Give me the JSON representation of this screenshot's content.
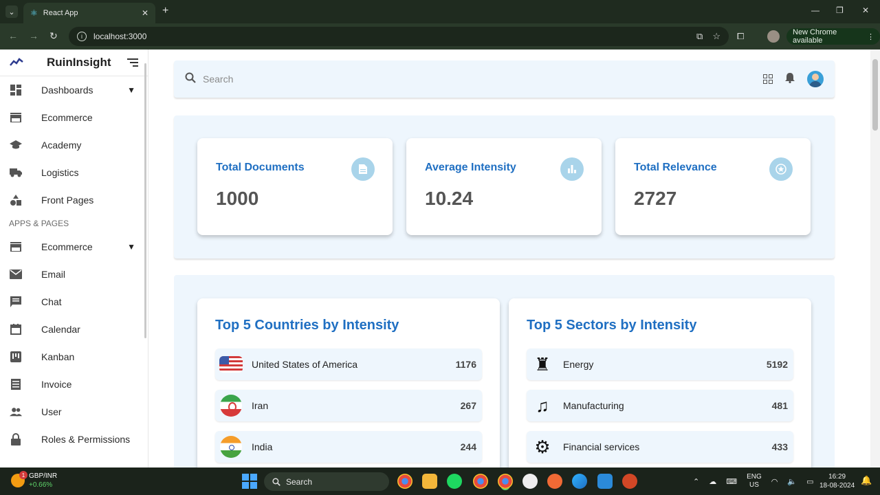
{
  "browser": {
    "tab_title": "React App",
    "url": "localhost:3000",
    "update_label": "New Chrome available"
  },
  "sidebar": {
    "brand": "RuinInsight",
    "items_top": [
      {
        "label": "Dashboards",
        "icon": "dashboard-icon",
        "expandable": true
      },
      {
        "label": "Ecommerce",
        "icon": "store-icon",
        "expandable": false
      },
      {
        "label": "Academy",
        "icon": "graduation-cap-icon",
        "expandable": false
      },
      {
        "label": "Logistics",
        "icon": "truck-icon",
        "expandable": false
      },
      {
        "label": "Front Pages",
        "icon": "shapes-icon",
        "expandable": false
      }
    ],
    "section_label": "APPS & PAGES",
    "items_apps": [
      {
        "label": "Ecommerce",
        "icon": "store-icon",
        "expandable": true
      },
      {
        "label": "Email",
        "icon": "email-icon",
        "expandable": false
      },
      {
        "label": "Chat",
        "icon": "chat-icon",
        "expandable": false
      },
      {
        "label": "Calendar",
        "icon": "calendar-icon",
        "expandable": false
      },
      {
        "label": "Kanban",
        "icon": "kanban-icon",
        "expandable": false
      },
      {
        "label": "Invoice",
        "icon": "invoice-icon",
        "expandable": false
      },
      {
        "label": "User",
        "icon": "users-icon",
        "expandable": false
      },
      {
        "label": "Roles & Permissions",
        "icon": "lock-icon",
        "expandable": false
      }
    ]
  },
  "topbar": {
    "search_placeholder": "Search"
  },
  "stats": [
    {
      "title": "Total Documents",
      "value": "1000",
      "icon": "document-icon"
    },
    {
      "title": "Average Intensity",
      "value": "10.24",
      "icon": "bar-chart-icon"
    },
    {
      "title": "Total Relevance",
      "value": "2727",
      "icon": "star-icon"
    }
  ],
  "countries": {
    "title": "Top 5 Countries by Intensity",
    "rows": [
      {
        "name": "United States of America",
        "value": "1176",
        "flag": "us"
      },
      {
        "name": "Iran",
        "value": "267",
        "flag": "ir"
      },
      {
        "name": "India",
        "value": "244",
        "flag": "in"
      }
    ]
  },
  "sectors": {
    "title": "Top 5 Sectors by Intensity",
    "rows": [
      {
        "name": "Energy",
        "value": "5192",
        "icon": "chess-rook-icon"
      },
      {
        "name": "Manufacturing",
        "value": "481",
        "icon": "music-note-icon"
      },
      {
        "name": "Financial services",
        "value": "433",
        "icon": "gears-icon"
      }
    ]
  },
  "taskbar": {
    "ticker_symbol": "GBP/INR",
    "ticker_change": "+0.66%",
    "ticker_badge": "1",
    "search_label": "Search",
    "lang_top": "ENG",
    "lang_bottom": "US",
    "time": "16:29",
    "date": "18-08-2024"
  }
}
